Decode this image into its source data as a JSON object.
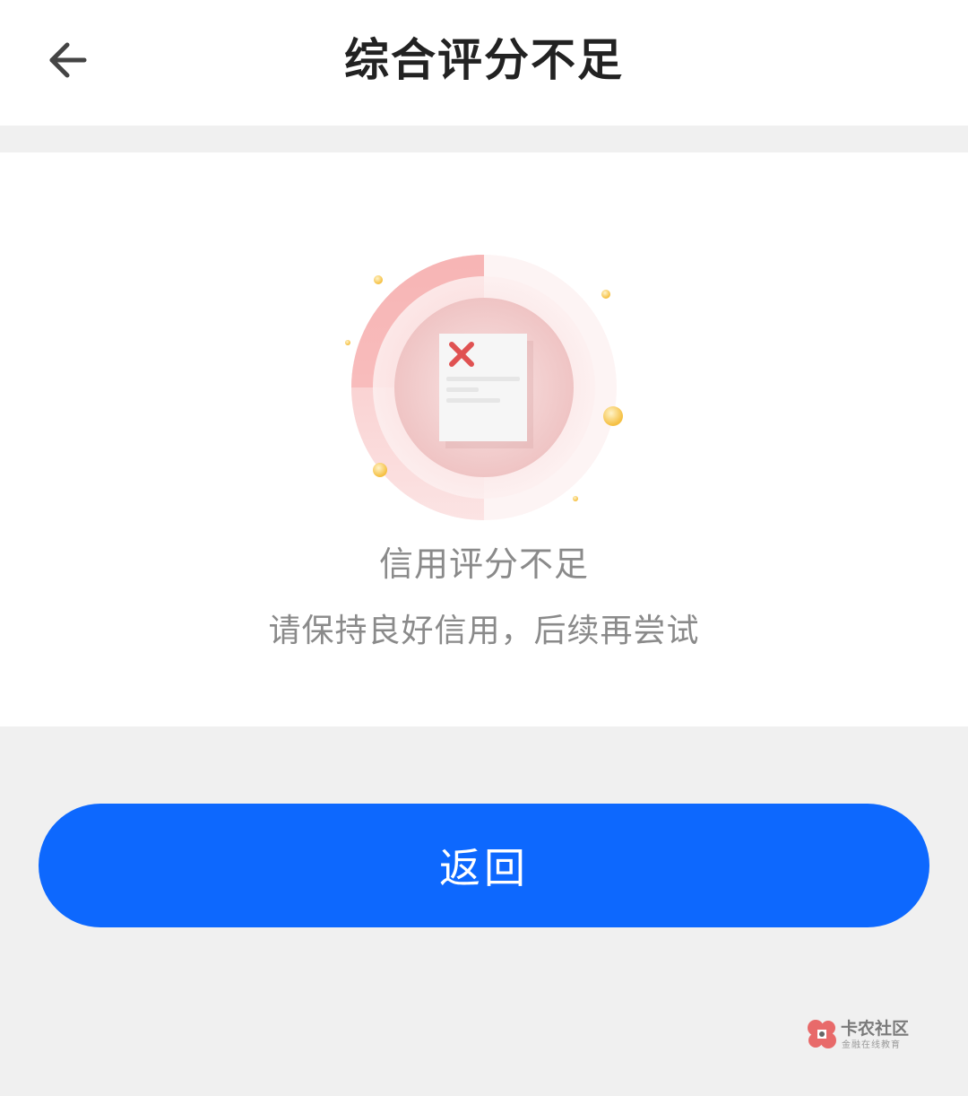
{
  "header": {
    "title": "综合评分不足",
    "back_icon": "arrow-left-icon"
  },
  "result": {
    "illustration_icon": "rejected-document-icon",
    "title": "信用评分不足",
    "description": "请保持良好信用，后续再尝试"
  },
  "actions": {
    "return_label": "返回"
  },
  "watermark": {
    "title": "卡农社区",
    "subtitle": "金融在线教育"
  },
  "colors": {
    "primary": "#0d68fe",
    "reject": "#e05252",
    "page_bg": "#f0f0f0",
    "text_gray": "#8a8a8a"
  }
}
